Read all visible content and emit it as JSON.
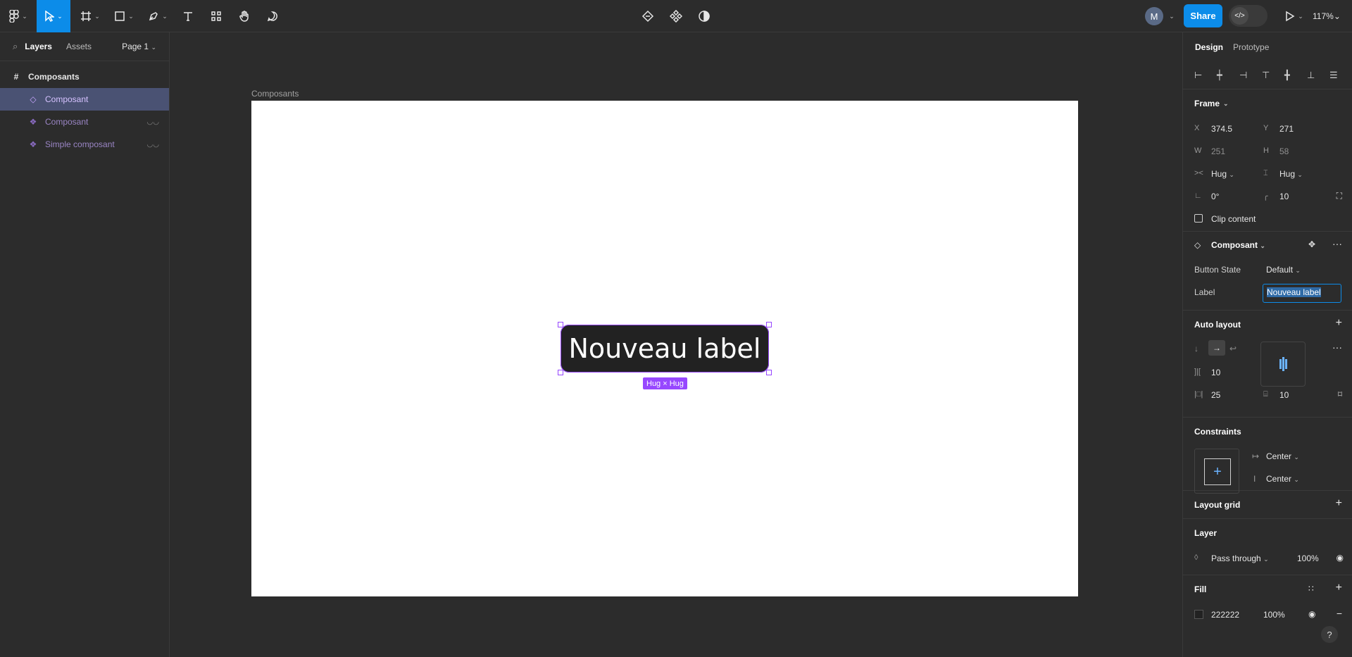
{
  "toolbar": {
    "share_label": "Share",
    "avatar_initial": "M",
    "zoom_label": "117%"
  },
  "left_panel": {
    "tabs": [
      "Layers",
      "Assets"
    ],
    "page_selector": "Page 1",
    "layers": [
      {
        "label": "Composants",
        "type": "frame"
      },
      {
        "label": "Composant",
        "type": "component",
        "selected": true
      },
      {
        "label": "Composant",
        "type": "instance",
        "hidden": true
      },
      {
        "label": "Simple composant",
        "type": "instance",
        "hidden": true
      }
    ]
  },
  "canvas": {
    "frame_label": "Composants",
    "button_text": "Nouveau label",
    "size_tag": "Hug × Hug"
  },
  "right_panel": {
    "tabs": [
      "Design",
      "Prototype"
    ],
    "frame": {
      "title": "Frame",
      "x_label": "X",
      "x": "374.5",
      "y_label": "Y",
      "y": "271",
      "w_label": "W",
      "w": "251",
      "h_label": "H",
      "h": "58",
      "horiz_resize": "Hug",
      "vert_resize": "Hug",
      "rotation": "0°",
      "radius": "10",
      "clip_content": "Clip content"
    },
    "component": {
      "title": "Composant",
      "prop1_label": "Button State",
      "prop1_value": "Default",
      "prop2_label": "Label",
      "prop2_value": "Nouveau label"
    },
    "auto_layout": {
      "title": "Auto layout",
      "gap": "10",
      "padding_h": "25",
      "padding_v": "10"
    },
    "constraints": {
      "title": "Constraints",
      "horizontal": "Center",
      "vertical": "Center"
    },
    "layout_grid": {
      "title": "Layout grid"
    },
    "layer": {
      "title": "Layer",
      "blend": "Pass through",
      "opacity": "100%"
    },
    "fill": {
      "title": "Fill",
      "hex": "222222",
      "opacity": "100%",
      "swatch": "#222222"
    }
  },
  "help": "?"
}
